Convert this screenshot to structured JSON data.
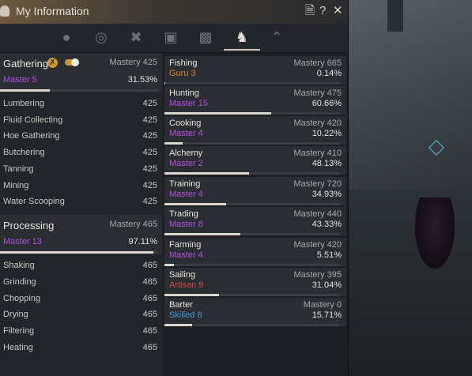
{
  "window": {
    "title": "My Information",
    "close_icon": "close-icon",
    "help_icon": "help-icon",
    "doc_icon": "document-icon"
  },
  "tabs": [
    {
      "name": "profile",
      "icon": "person-icon"
    },
    {
      "name": "medal",
      "icon": "medal-icon"
    },
    {
      "name": "combat",
      "icon": "crossed-tools-icon"
    },
    {
      "name": "gift",
      "icon": "gift-icon"
    },
    {
      "name": "stats",
      "icon": "bar-chart-icon"
    },
    {
      "name": "life-skills",
      "icon": "horse-icon",
      "active": true
    },
    {
      "name": "rank",
      "icon": "chevron-up-icon"
    }
  ],
  "gathering": {
    "name": "Gathering",
    "mastery": "Mastery 425",
    "rank": "Master 5",
    "percent": "31.53%",
    "progress": 0.3153,
    "subskills": [
      {
        "name": "Lumbering",
        "value": "425"
      },
      {
        "name": "Fluid Collecting",
        "value": "425"
      },
      {
        "name": "Hoe Gathering",
        "value": "425"
      },
      {
        "name": "Butchering",
        "value": "425"
      },
      {
        "name": "Tanning",
        "value": "425"
      },
      {
        "name": "Mining",
        "value": "425"
      },
      {
        "name": "Water Scooping",
        "value": "425"
      }
    ]
  },
  "processing": {
    "name": "Processing",
    "mastery": "Mastery 465",
    "rank": "Master 13",
    "percent": "97.11%",
    "progress": 0.9711,
    "subskills": [
      {
        "name": "Shaking",
        "value": "465"
      },
      {
        "name": "Grinding",
        "value": "465"
      },
      {
        "name": "Chopping",
        "value": "465"
      },
      {
        "name": "Drying",
        "value": "465"
      },
      {
        "name": "Filtering",
        "value": "465"
      },
      {
        "name": "Heating",
        "value": "465"
      }
    ]
  },
  "skills": [
    {
      "name": "Fishing",
      "mastery": "Mastery 665",
      "rank": "Guru 3",
      "rank_color": "#d9882b",
      "percent": "0.14%",
      "progress": 0.0014
    },
    {
      "name": "Hunting",
      "mastery": "Mastery 475",
      "rank": "Master 15",
      "rank_color": "#b44ee3",
      "percent": "60.66%",
      "progress": 0.6066
    },
    {
      "name": "Cooking",
      "mastery": "Mastery 420",
      "rank": "Master 4",
      "rank_color": "#b44ee3",
      "percent": "10.22%",
      "progress": 0.1022
    },
    {
      "name": "Alchemy",
      "mastery": "Mastery 410",
      "rank": "Master 2",
      "rank_color": "#b44ee3",
      "percent": "48.13%",
      "progress": 0.4813
    },
    {
      "name": "Training",
      "mastery": "Mastery 720",
      "rank": "Master 4",
      "rank_color": "#b44ee3",
      "percent": "34.93%",
      "progress": 0.3493
    },
    {
      "name": "Trading",
      "mastery": "Mastery 440",
      "rank": "Master 8",
      "rank_color": "#b44ee3",
      "percent": "43.33%",
      "progress": 0.4333
    },
    {
      "name": "Farming",
      "mastery": "Mastery 420",
      "rank": "Master 4",
      "rank_color": "#b44ee3",
      "percent": "5.51%",
      "progress": 0.0551
    },
    {
      "name": "Sailing",
      "mastery": "Mastery 395",
      "rank": "Artisan 9",
      "rank_color": "#d14a3a",
      "percent": "31.04%",
      "progress": 0.3104
    },
    {
      "name": "Barter",
      "mastery": "Mastery 0",
      "rank": "Skilled 8",
      "rank_color": "#3f9ad6",
      "percent": "15.71%",
      "progress": 0.1571
    }
  ]
}
